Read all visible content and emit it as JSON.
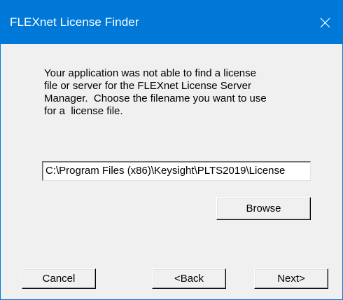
{
  "window": {
    "title": "FLEXnet License Finder",
    "accent_color": "#0078d7",
    "close_icon": "close-icon"
  },
  "dialog": {
    "message": "Your application was not able to find a license\nfile or server for the FLEXnet License Server\nManager.  Choose the filename you want to use\nfor a  license file.",
    "license_path_value": "C:\\Program Files (x86)\\Keysight\\PLTS2019\\License"
  },
  "buttons": {
    "browse_label": "Browse",
    "cancel_label": "Cancel",
    "back_label": "<Back",
    "next_label": "Next>"
  }
}
